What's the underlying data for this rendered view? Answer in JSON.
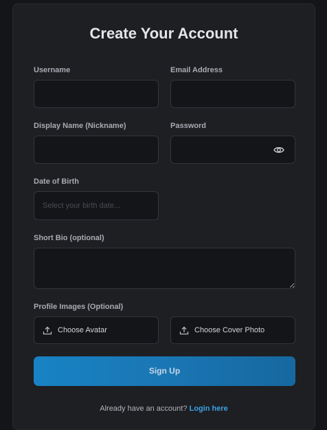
{
  "form": {
    "title": "Create Your Account",
    "username": {
      "label": "Username",
      "value": ""
    },
    "email": {
      "label": "Email Address",
      "value": ""
    },
    "display_name": {
      "label": "Display Name (Nickname)",
      "value": ""
    },
    "password": {
      "label": "Password",
      "value": "",
      "toggle_icon": "eye-icon"
    },
    "dob": {
      "label": "Date of Birth",
      "placeholder": "Select your birth date..."
    },
    "bio": {
      "label": "Short Bio (optional)",
      "value": ""
    },
    "images": {
      "label": "Profile Images (Optional)",
      "avatar_button": "Choose Avatar",
      "cover_button": "Choose Cover Photo",
      "icon": "upload-icon"
    },
    "submit_label": "Sign Up",
    "footer": {
      "text": "Already have an account?",
      "link": "Login here"
    }
  },
  "colors": {
    "page_bg": "#141518",
    "card_bg": "#1e1f23",
    "field_bg": "#141518",
    "accent": "#1a7bbd",
    "link": "#3aa3e6"
  }
}
